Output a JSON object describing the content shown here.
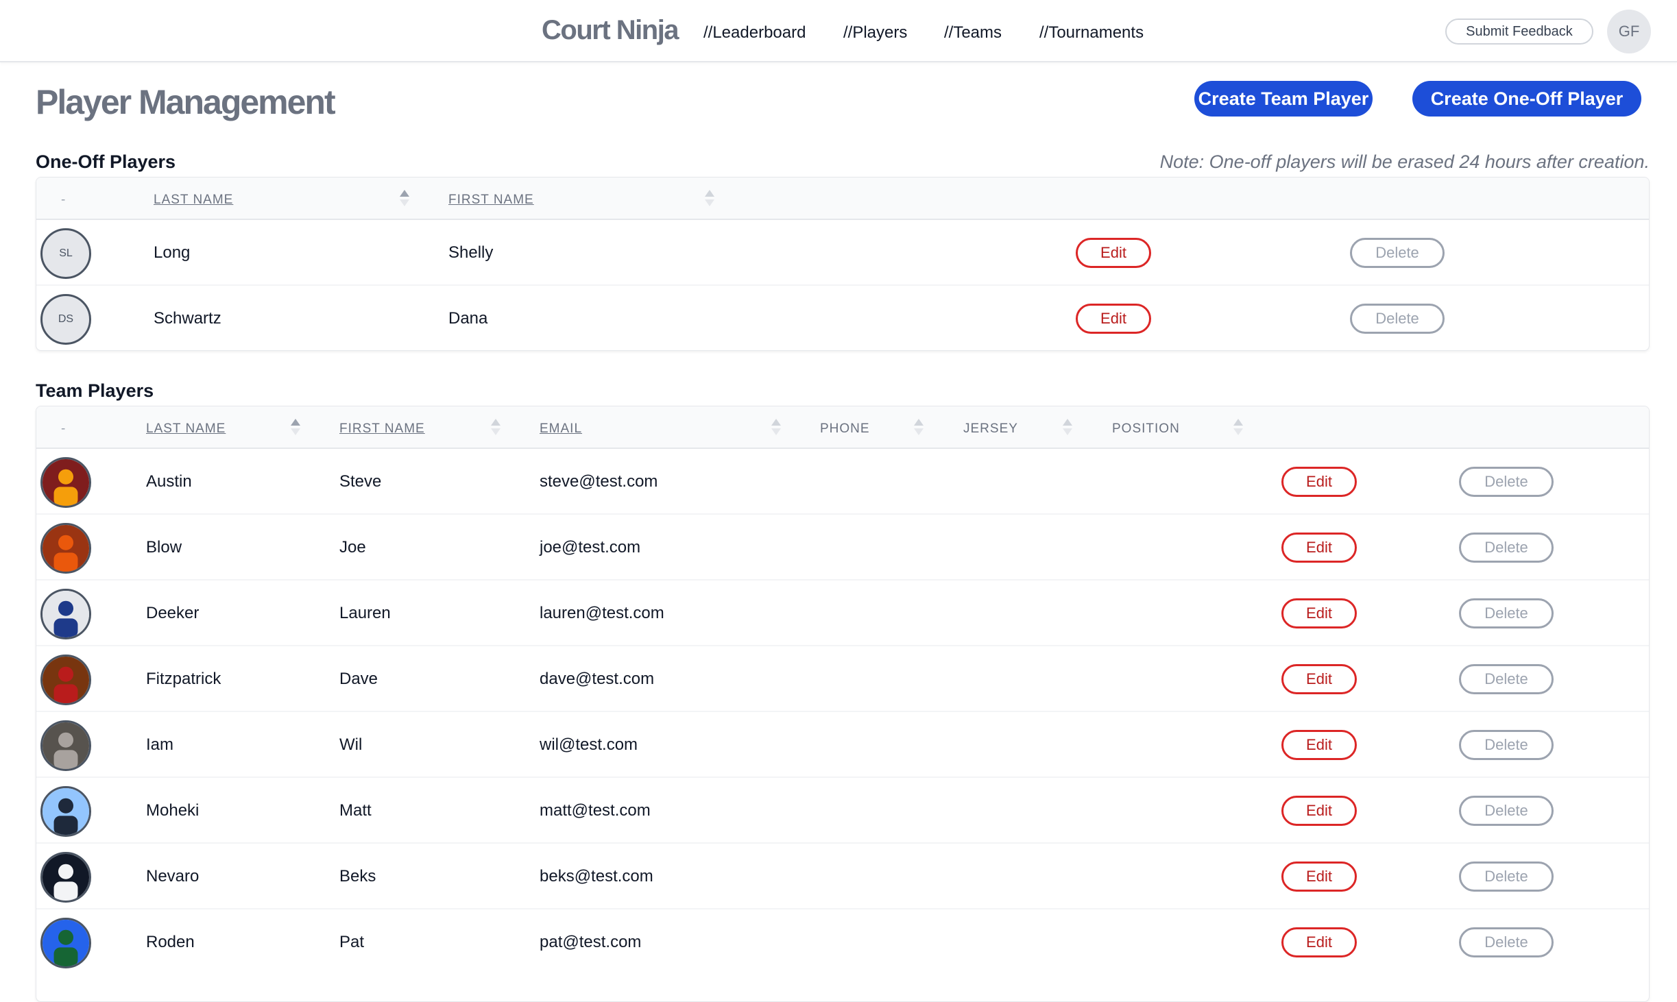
{
  "header": {
    "brand": "Court Ninja",
    "nav": [
      "//Leaderboard",
      "//Players",
      "//Teams",
      "//Tournaments"
    ],
    "feedback_label": "Submit Feedback",
    "user_initials": "GF"
  },
  "page": {
    "title": "Player Management",
    "create_team_label": "Create Team Player",
    "create_oneoff_label": "Create One-Off Player"
  },
  "oneoff": {
    "title": "One-Off Players",
    "note": "Note: One-off players will be erased 24 hours after creation.",
    "columns": {
      "dash": "-",
      "last": "LAST NAME",
      "first": "FIRST NAME"
    },
    "rows": [
      {
        "initials": "SL",
        "last": "Long",
        "first": "Shelly",
        "edit": "Edit",
        "delete": "Delete"
      },
      {
        "initials": "DS",
        "last": "Schwartz",
        "first": "Dana",
        "edit": "Edit",
        "delete": "Delete"
      }
    ]
  },
  "team": {
    "title": "Team Players",
    "columns": {
      "dash": "-",
      "last": "LAST NAME",
      "first": "FIRST NAME",
      "email": "EMAIL",
      "phone": "PHONE",
      "jersey": "JERSEY",
      "position": "POSITION"
    },
    "rows": [
      {
        "last": "Austin",
        "first": "Steve",
        "email": "steve@test.com",
        "edit": "Edit",
        "delete": "Delete",
        "photo_colors": [
          "#7f1d1d",
          "#f59e0b"
        ]
      },
      {
        "last": "Blow",
        "first": "Joe",
        "email": "joe@test.com",
        "edit": "Edit",
        "delete": "Delete",
        "photo_colors": [
          "#9a3412",
          "#ea580c"
        ]
      },
      {
        "last": "Deeker",
        "first": "Lauren",
        "email": "lauren@test.com",
        "edit": "Edit",
        "delete": "Delete",
        "photo_colors": [
          "#e5e7eb",
          "#1e3a8a"
        ]
      },
      {
        "last": "Fitzpatrick",
        "first": "Dave",
        "email": "dave@test.com",
        "edit": "Edit",
        "delete": "Delete",
        "photo_colors": [
          "#78350f",
          "#b91c1c"
        ]
      },
      {
        "last": "Iam",
        "first": "Wil",
        "email": "wil@test.com",
        "edit": "Edit",
        "delete": "Delete",
        "photo_colors": [
          "#57534e",
          "#a8a29e"
        ]
      },
      {
        "last": "Moheki",
        "first": "Matt",
        "email": "matt@test.com",
        "edit": "Edit",
        "delete": "Delete",
        "photo_colors": [
          "#93c5fd",
          "#1e293b"
        ]
      },
      {
        "last": "Nevaro",
        "first": "Beks",
        "email": "beks@test.com",
        "edit": "Edit",
        "delete": "Delete",
        "photo_colors": [
          "#111827",
          "#f3f4f6"
        ]
      },
      {
        "last": "Roden",
        "first": "Pat",
        "email": "pat@test.com",
        "edit": "Edit",
        "delete": "Delete",
        "photo_colors": [
          "#2563eb",
          "#166534"
        ]
      }
    ]
  }
}
